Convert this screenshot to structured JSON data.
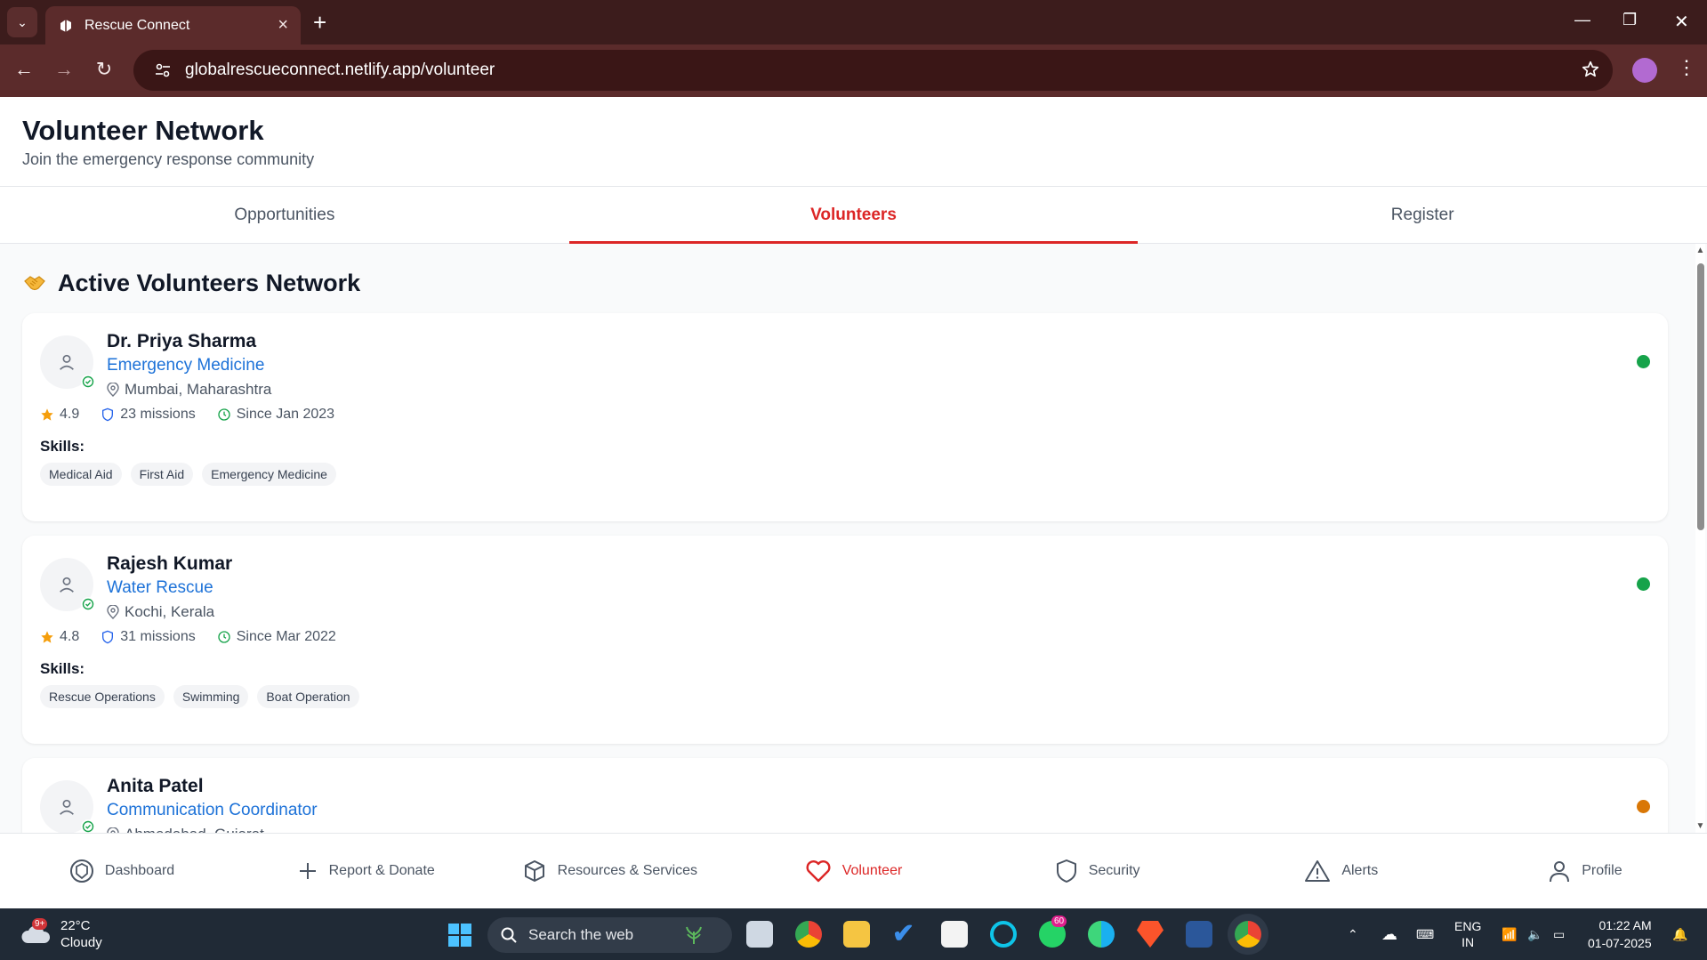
{
  "browser": {
    "tab_title": "Rescue Connect",
    "url": "globalrescueconnect.netlify.app/volunteer"
  },
  "header": {
    "title": "Volunteer Network",
    "subtitle": "Join the emergency response community"
  },
  "tabs": [
    {
      "label": "Opportunities",
      "active": false
    },
    {
      "label": "Volunteers",
      "active": true
    },
    {
      "label": "Register",
      "active": false
    }
  ],
  "section": {
    "title": "Active Volunteers Network"
  },
  "skills_label": "Skills:",
  "volunteers": [
    {
      "name": "Dr. Priya Sharma",
      "specialty": "Emergency Medicine",
      "location": "Mumbai, Maharashtra",
      "rating": "4.9",
      "missions": "23 missions",
      "since": "Since Jan 2023",
      "skills": [
        "Medical Aid",
        "First Aid",
        "Emergency Medicine"
      ],
      "status_color": "#16a34a"
    },
    {
      "name": "Rajesh Kumar",
      "specialty": "Water Rescue",
      "location": "Kochi, Kerala",
      "rating": "4.8",
      "missions": "31 missions",
      "since": "Since Mar 2022",
      "skills": [
        "Rescue Operations",
        "Swimming",
        "Boat Operation"
      ],
      "status_color": "#16a34a"
    },
    {
      "name": "Anita Patel",
      "specialty": "Communication Coordinator",
      "location": "Ahmedabad, Gujarat",
      "rating": "",
      "missions": "",
      "since": "",
      "skills": [],
      "status_color": "#d97706"
    }
  ],
  "bottom_nav": [
    {
      "label": "Dashboard",
      "icon": "dashboard-icon"
    },
    {
      "label": "Report & Donate",
      "icon": "plus-icon"
    },
    {
      "label": "Resources & Services",
      "icon": "box-icon"
    },
    {
      "label": "Volunteer",
      "icon": "heart-icon",
      "active": true
    },
    {
      "label": "Security",
      "icon": "shield-icon"
    },
    {
      "label": "Alerts",
      "icon": "alert-triangle-icon"
    },
    {
      "label": "Profile",
      "icon": "user-icon"
    }
  ],
  "taskbar": {
    "weather_temp": "22°C",
    "weather_desc": "Cloudy",
    "weather_badge": "9+",
    "search_placeholder": "Search the web",
    "whatsapp_badge": "60",
    "lang_top": "ENG",
    "lang_bottom": "IN",
    "time": "01:22 AM",
    "date": "01-07-2025"
  },
  "colors": {
    "accent": "#dc2626",
    "link": "#1d72d8",
    "online": "#16a34a",
    "busy": "#d97706"
  }
}
